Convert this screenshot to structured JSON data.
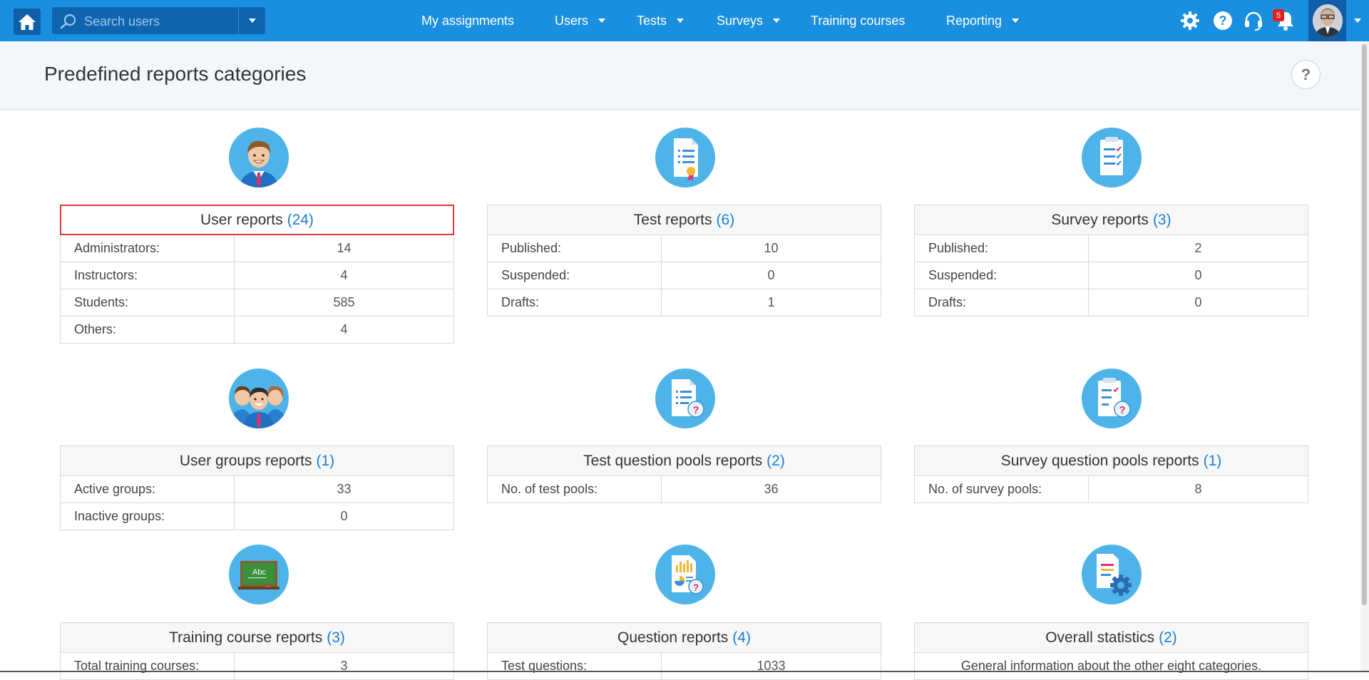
{
  "search": {
    "placeholder": "Search users"
  },
  "nav": {
    "items": [
      {
        "label": "My assignments"
      },
      {
        "label": "Users"
      },
      {
        "label": "Tests"
      },
      {
        "label": "Surveys"
      },
      {
        "label": "Training courses"
      },
      {
        "label": "Reporting"
      }
    ],
    "notification_count": "5"
  },
  "header": {
    "title": "Predefined reports categories",
    "help": "?"
  },
  "categories": [
    {
      "title": "User reports",
      "count": "(24)",
      "icon": "user-icon",
      "rows": [
        {
          "label": "Administrators:",
          "value": "14"
        },
        {
          "label": "Instructors:",
          "value": "4"
        },
        {
          "label": "Students:",
          "value": "585"
        },
        {
          "label": "Others:",
          "value": "4"
        }
      ]
    },
    {
      "title": "Test reports",
      "count": "(6)",
      "icon": "test-document-icon",
      "rows": [
        {
          "label": "Published:",
          "value": "10"
        },
        {
          "label": "Suspended:",
          "value": "0"
        },
        {
          "label": "Drafts:",
          "value": "1"
        }
      ]
    },
    {
      "title": "Survey reports",
      "count": "(3)",
      "icon": "survey-clipboard-icon",
      "rows": [
        {
          "label": "Published:",
          "value": "2"
        },
        {
          "label": "Suspended:",
          "value": "0"
        },
        {
          "label": "Drafts:",
          "value": "0"
        }
      ]
    },
    {
      "title": "User groups reports",
      "count": "(1)",
      "icon": "user-group-icon",
      "rows": [
        {
          "label": "Active groups:",
          "value": "33"
        },
        {
          "label": "Inactive groups:",
          "value": "0"
        }
      ]
    },
    {
      "title": "Test question pools reports",
      "count": "(2)",
      "icon": "test-question-pool-icon",
      "rows": [
        {
          "label": "No. of test pools:",
          "value": "36"
        }
      ]
    },
    {
      "title": "Survey question pools reports",
      "count": "(1)",
      "icon": "survey-question-pool-icon",
      "rows": [
        {
          "label": "No. of survey pools:",
          "value": "8"
        }
      ]
    },
    {
      "title": "Training course reports",
      "count": "(3)",
      "icon": "chalkboard-icon",
      "board_text": "Abc",
      "rows": [
        {
          "label": "Total training courses:",
          "value": "3"
        }
      ]
    },
    {
      "title": "Question reports",
      "count": "(4)",
      "icon": "question-chart-icon",
      "rows": [
        {
          "label": "Test questions:",
          "value": "1033"
        }
      ]
    },
    {
      "title": "Overall statistics",
      "count": "(2)",
      "icon": "statistics-gear-icon",
      "description": "General information about the other eight categories."
    }
  ],
  "colors": {
    "nav": "#1a8fe0",
    "accent": "#1a7fd0",
    "selected_border": "#d93a3a"
  }
}
